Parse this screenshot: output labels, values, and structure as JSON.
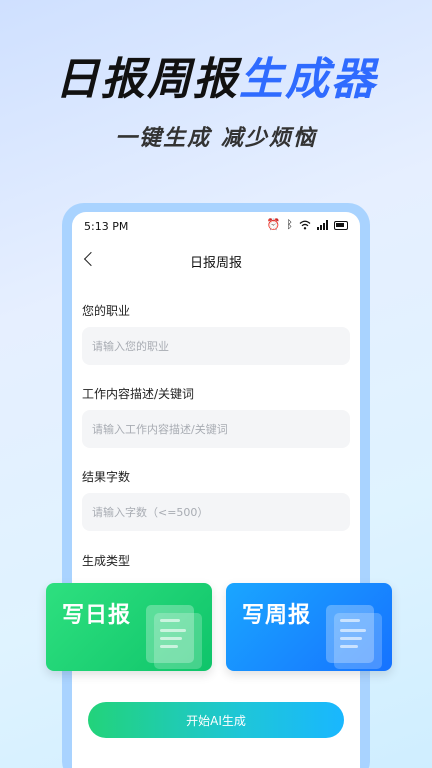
{
  "hero": {
    "title_dark": "日报周报",
    "title_blue": "生成器",
    "subtitle": "一键生成 减少烦恼"
  },
  "status_bar": {
    "time": "5:13 PM",
    "icons": [
      "alarm-icon",
      "bluetooth-icon",
      "wifi-icon",
      "signal-icon",
      "battery-icon"
    ]
  },
  "nav": {
    "title": "日报周报"
  },
  "form": {
    "job": {
      "label": "您的职业",
      "placeholder": "请输入您的职业",
      "value": ""
    },
    "content": {
      "label": "工作内容描述/关键词",
      "placeholder": "请输入工作内容描述/关键词",
      "value": ""
    },
    "word_count": {
      "label": "结果字数",
      "placeholder": "请输入字数（<=500）",
      "value": ""
    },
    "type_label": "生成类型"
  },
  "types": [
    {
      "label": "写日报",
      "color": "#14c96e"
    },
    {
      "label": "写周报",
      "color": "#1672ff"
    }
  ],
  "start_button": "开始AI生成",
  "colors": {
    "accent_blue": "#2f6bff",
    "green": "#14c96e"
  }
}
